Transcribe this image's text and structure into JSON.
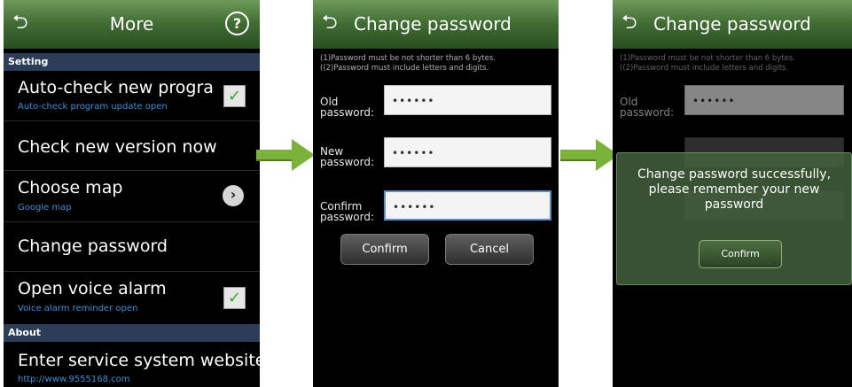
{
  "screens": {
    "more": {
      "title": "More",
      "help_glyph": "?",
      "back_glyph": "⮌",
      "setting_header": "Setting",
      "about_header": "About",
      "items": [
        {
          "label": "Auto-check new program",
          "sub": "Auto-check program update open",
          "control": "checkbox",
          "checked": true
        },
        {
          "label": "Check new version now"
        },
        {
          "label": "Choose map",
          "sub": "Google map",
          "control": "chevron"
        },
        {
          "label": "Change password"
        },
        {
          "label": "Open voice alarm",
          "sub": "Voice alarm reminder open",
          "control": "checkbox",
          "checked": true
        }
      ],
      "about_item": {
        "label": "Enter service system website",
        "sub": "http://www.9555168.com"
      },
      "check_glyph": "✓",
      "chevron_glyph": "›"
    },
    "change_password": {
      "title": "Change password",
      "back_glyph": "⮌",
      "hint_line1": "(1)Password must be not shorter than 6 bytes.",
      "hint_line2": "((2)Password must include letters and digits.",
      "fields": [
        {
          "label_line1": "Old",
          "label_line2": "password:",
          "value": "••••••"
        },
        {
          "label_line1": "New",
          "label_line2": "password:",
          "value": "••••••"
        },
        {
          "label_line1": "Confirm",
          "label_line2": "password:",
          "value": "••••••"
        }
      ],
      "confirm_label": "Confirm",
      "cancel_label": "Cancel"
    },
    "success": {
      "title": "Change password",
      "back_glyph": "⮌",
      "hint_line1": "(1)Password must be not shorter than 6 bytes.",
      "hint_line2": "((2)Password must include letters and digits.",
      "old_label_line1": "Old",
      "old_label_line2": "password:",
      "old_value": "••••••",
      "dialog_line1": "Change password successfully,",
      "dialog_line2": "please remember your new",
      "dialog_line3": "password",
      "dialog_button": "Confirm"
    }
  },
  "colors": {
    "titlebar": "#3f6b32",
    "section_header": "#2b3d59",
    "subtext": "#3d8fd9",
    "arrow": "#7bb23a"
  }
}
